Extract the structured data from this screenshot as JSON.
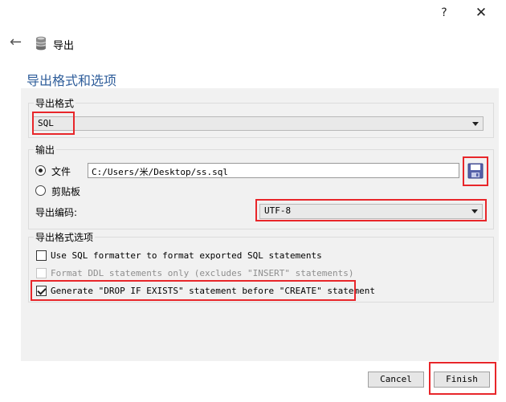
{
  "window": {
    "help_label": "?",
    "close_label": "✕"
  },
  "header": {
    "back_icon": "back-arrow-icon",
    "db_icon": "database-icon",
    "title": "导出"
  },
  "section_title": "导出格式和选项",
  "format_group": {
    "legend": "导出格式",
    "selected": "SQL"
  },
  "output_group": {
    "legend": "输出",
    "file_label": "文件",
    "file_path": "C:/Users/米/Desktop/ss.sql",
    "clipboard_label": "剪贴板",
    "encoding_label": "导出编码:",
    "encoding_value": "UTF-8",
    "file_selected": true
  },
  "options_group": {
    "legend": "导出格式选项",
    "options": [
      {
        "label": "Use SQL formatter to format exported SQL statements",
        "checked": false,
        "disabled": false
      },
      {
        "label": "Format DDL statements only (excludes \"INSERT\" statements)",
        "checked": false,
        "disabled": true
      },
      {
        "label": "Generate \"DROP IF EXISTS\" statement before \"CREATE\" statement",
        "checked": true,
        "disabled": false
      }
    ]
  },
  "footer": {
    "cancel_label": "Cancel",
    "finish_label": "Finish"
  },
  "colors": {
    "accent_title": "#2e5d9a",
    "highlight": "#e8262a"
  }
}
